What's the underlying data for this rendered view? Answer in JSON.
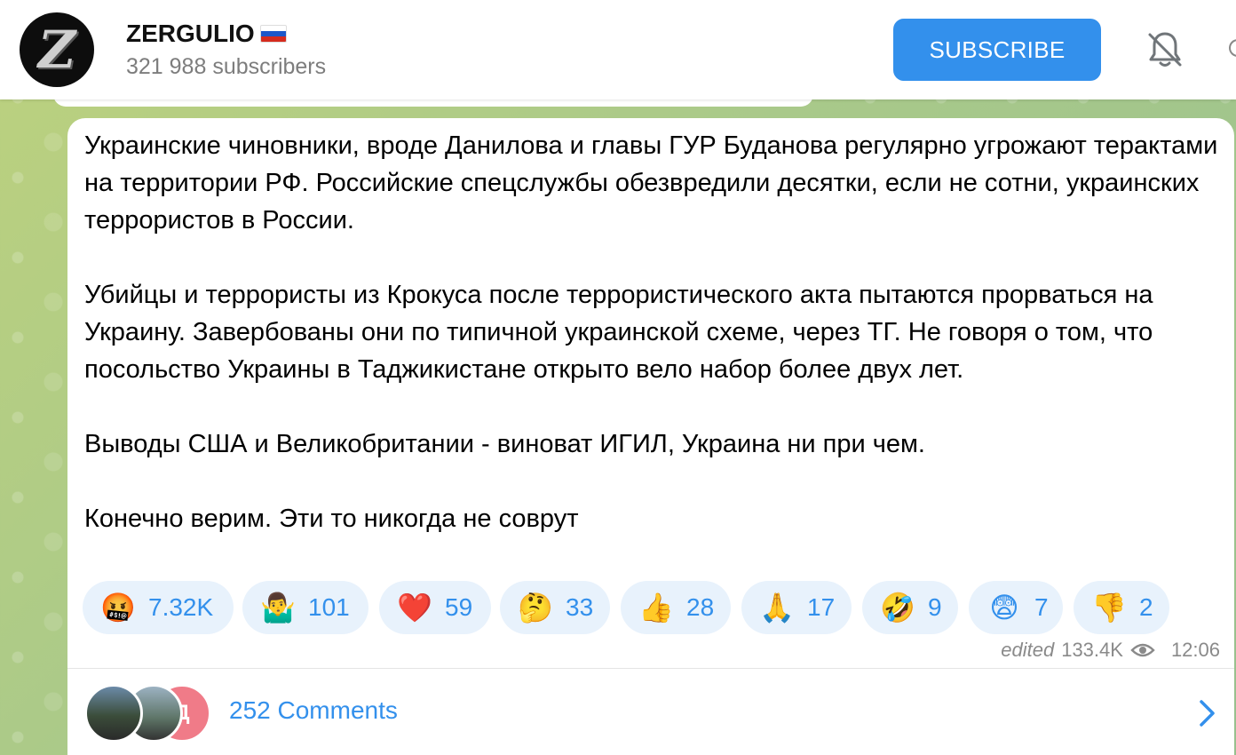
{
  "header": {
    "channel_name": "ZERGULIO",
    "channel_flag": "russia-flag",
    "avatar_letter": "Z",
    "subscribers": "321 988 subscribers",
    "subscribe_label": "SUBSCRIBE",
    "mute_icon": "bell-muted-icon"
  },
  "message": {
    "text": "Украинские чиновники, вроде Данилова и главы ГУР Буданова регулярно угрожают терактами на территории РФ. Российские спецслужбы обезвредили десятки, если не сотни, украинских террористов в России.\n\nУбийцы и террористы из Крокуса после террористического акта пытаются прорваться на Украину. Завербованы они по типичной украинской схеме, через ТГ. Не говоря о том, что посольство Украины в Таджикистане открыто вело набор более двух лет.\n\nВыводы США и Великобритании - виноват ИГИЛ, Украина ни при чем.\n\nКонечно верим. Эти то никогда не соврут",
    "reactions": [
      {
        "emoji": "🤬",
        "count": "7.32K"
      },
      {
        "emoji": "🤷‍♂️",
        "count": "101"
      },
      {
        "emoji": "❤️",
        "count": "59"
      },
      {
        "emoji": "🤔",
        "count": "33"
      },
      {
        "emoji": "👍",
        "count": "28"
      },
      {
        "emoji": "🙏",
        "count": "17"
      },
      {
        "emoji": "🤣",
        "count": "9"
      },
      {
        "emoji": "😨",
        "count": "7"
      },
      {
        "emoji": "👎",
        "count": "2"
      }
    ],
    "edited_label": "edited",
    "views": "133.4K",
    "time": "12:06"
  },
  "comments": {
    "label": "252 Comments",
    "avatar_letter": "Д"
  },
  "colors": {
    "accent": "#3390ec",
    "reaction_bg": "#e8f2fc",
    "background": "#a9c98a"
  }
}
